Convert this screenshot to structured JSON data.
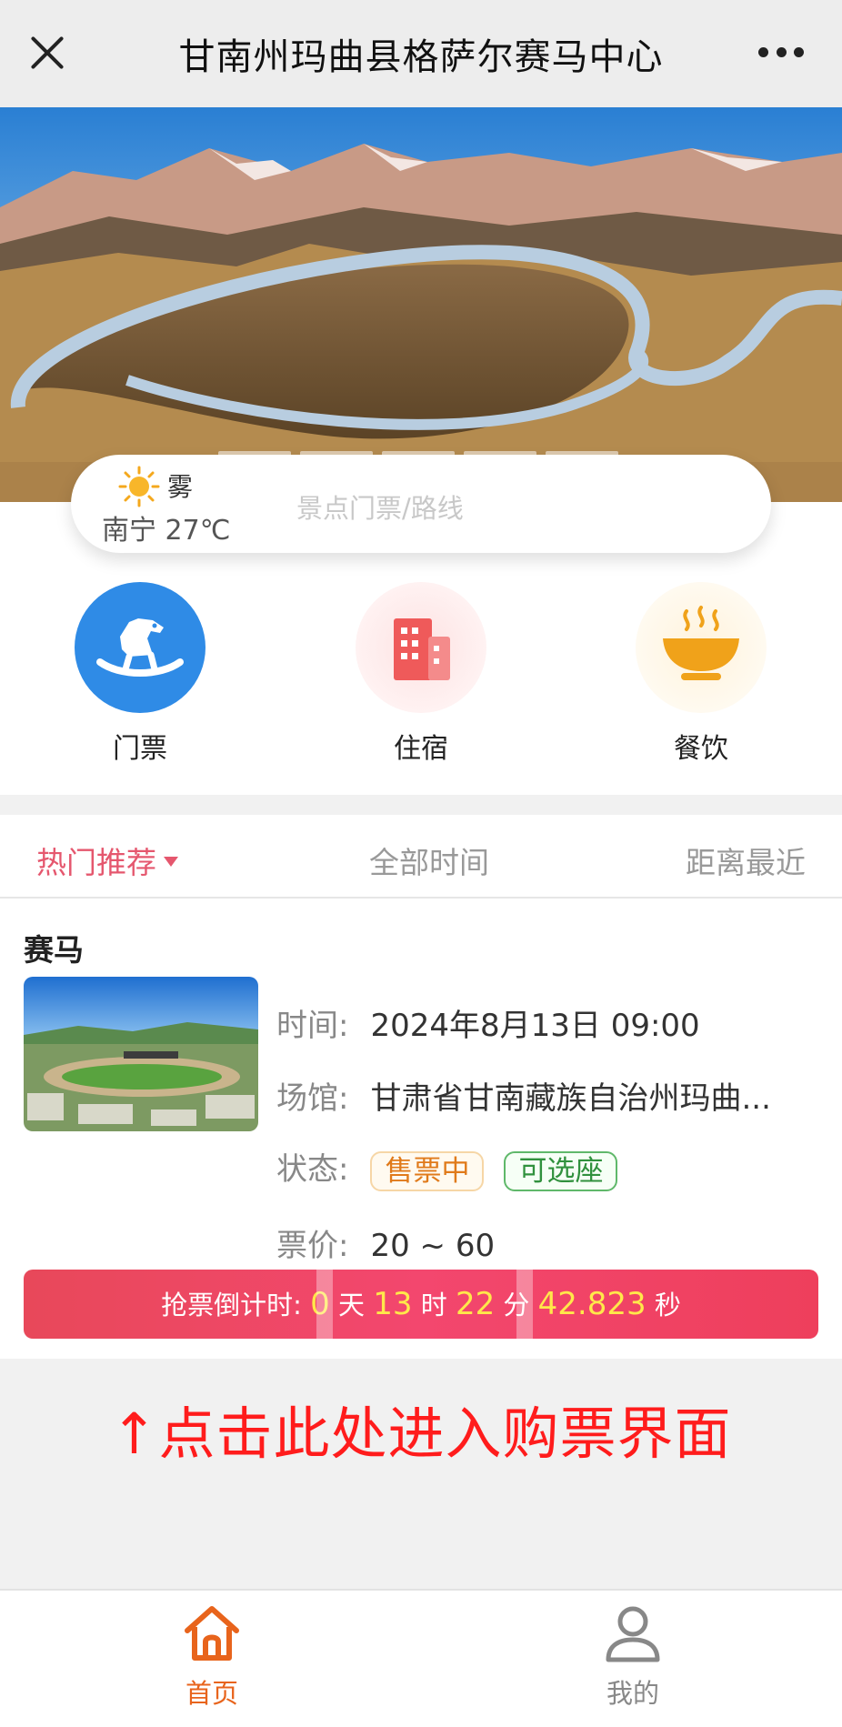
{
  "header": {
    "title": "甘南州玛曲县格萨尔赛马中心"
  },
  "weather": {
    "condition": "雾",
    "location_temp": "南宁 27℃"
  },
  "search": {
    "placeholder": "景点门票/路线"
  },
  "categories": [
    {
      "label": "门票",
      "icon": "rocking-horse-icon",
      "color": "#2f8be6"
    },
    {
      "label": "住宿",
      "icon": "building-icon",
      "color": "#ef5a5a"
    },
    {
      "label": "餐饮",
      "icon": "bowl-icon",
      "color": "#f0a21a"
    }
  ],
  "tabs": {
    "hot": "热门推荐",
    "all_time": "全部时间",
    "nearest": "距离最近"
  },
  "event": {
    "title": "赛马",
    "time_label": "时间:",
    "time_value": "2024年8月13日 09:00",
    "venue_label": "场馆:",
    "venue_value": "甘肃省甘南藏族自治州玛曲...",
    "status_label": "状态:",
    "status_badges": [
      "售票中",
      "可选座"
    ],
    "price_label": "票价:",
    "price_value": "20 ~ 60"
  },
  "countdown": {
    "label": "抢票倒计时:",
    "days": "0",
    "days_unit": "天",
    "hours": "13",
    "hours_unit": "时",
    "minutes": "22",
    "minutes_unit": "分",
    "seconds": "42.823",
    "seconds_unit": "秒"
  },
  "note": "↑点击此处进入购票界面",
  "bottom_nav": {
    "home": "首页",
    "mine": "我的"
  },
  "colors": {
    "accent": "#e5576e",
    "nav_active": "#e8641c",
    "countdown_num": "#ffe84a",
    "note": "#ff1c1c"
  }
}
